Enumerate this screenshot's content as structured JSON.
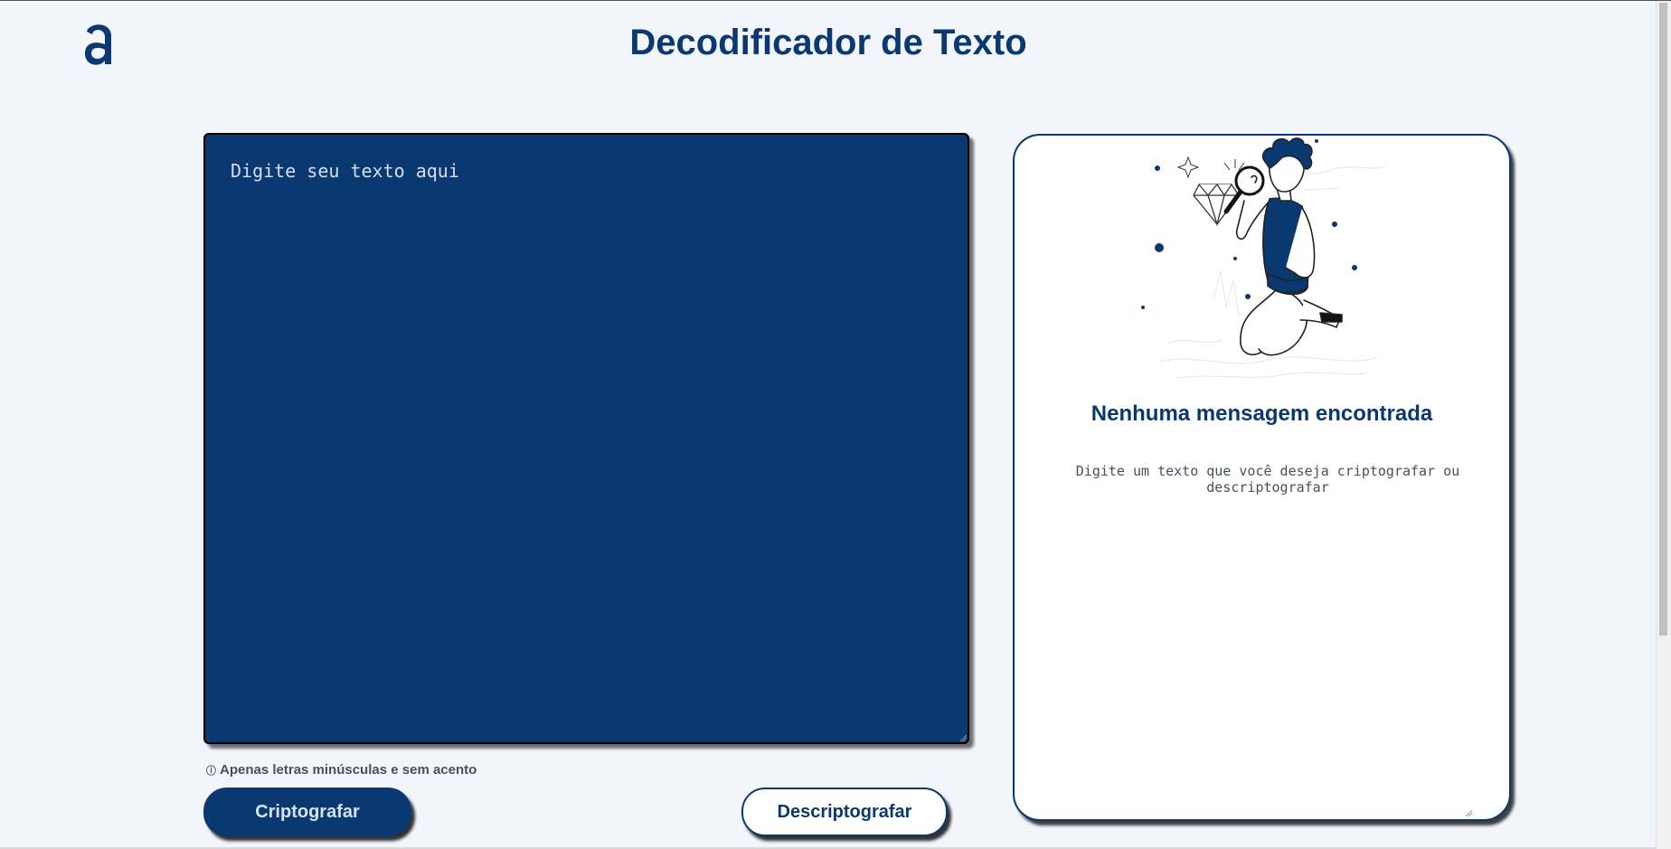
{
  "header": {
    "logo_icon": "alura-a-logo-icon",
    "title": "Decodificador de Texto"
  },
  "input": {
    "placeholder": "Digite seu texto aqui",
    "value": ""
  },
  "hint": {
    "icon": "info-icon",
    "text": "Apenas letras minúsculas e sem acento"
  },
  "buttons": {
    "encrypt_label": "Criptografar",
    "decrypt_label": "Descriptografar"
  },
  "output": {
    "illustration_icon": "boy-with-magnifying-glass-illustration",
    "title": "Nenhuma mensagem encontrada",
    "text": "Digite um texto que você deseja criptografar ou descriptografar"
  },
  "colors": {
    "primary": "#0a3871",
    "background": "#f3f5fc",
    "card": "#ffffff",
    "hint_text": "#495057"
  }
}
